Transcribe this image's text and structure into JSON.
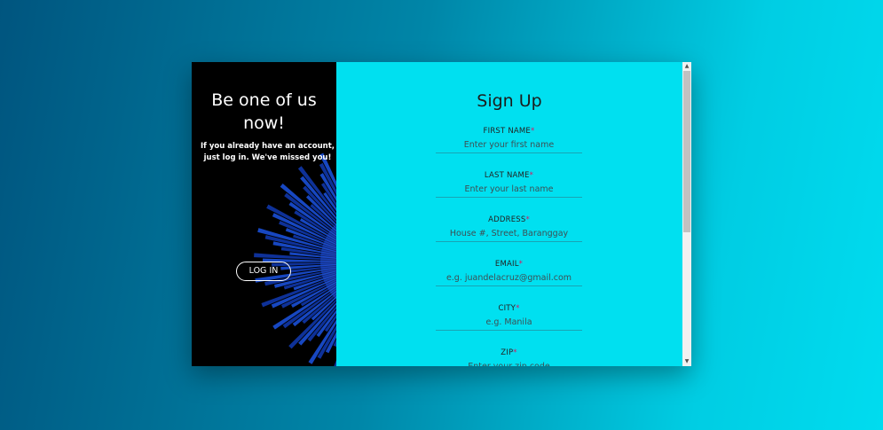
{
  "left_panel": {
    "title": "Be one of us now!",
    "subtitle": "If you already have an account, just log in. We've missed you!",
    "login_label": "LOG IN"
  },
  "form": {
    "title": "Sign Up",
    "required_mark": "*",
    "fields": [
      {
        "label": "FIRST NAME",
        "placeholder": "Enter your first name"
      },
      {
        "label": "LAST NAME",
        "placeholder": "Enter your last name"
      },
      {
        "label": "ADDRESS",
        "placeholder": "House #, Street, Baranggay"
      },
      {
        "label": "EMAIL",
        "placeholder": "e.g. juandelacruz@gmail.com"
      },
      {
        "label": "CITY",
        "placeholder": "e.g. Manila"
      },
      {
        "label": "ZIP",
        "placeholder": "Enter your zip code"
      }
    ]
  },
  "colors": {
    "form_bg": "#00e0f0",
    "left_bg": "#000000",
    "fish": "#1546c8",
    "required": "#e0115f"
  },
  "icons": {
    "scroll_up": "triangle-up-icon",
    "scroll_down": "triangle-down-icon"
  }
}
